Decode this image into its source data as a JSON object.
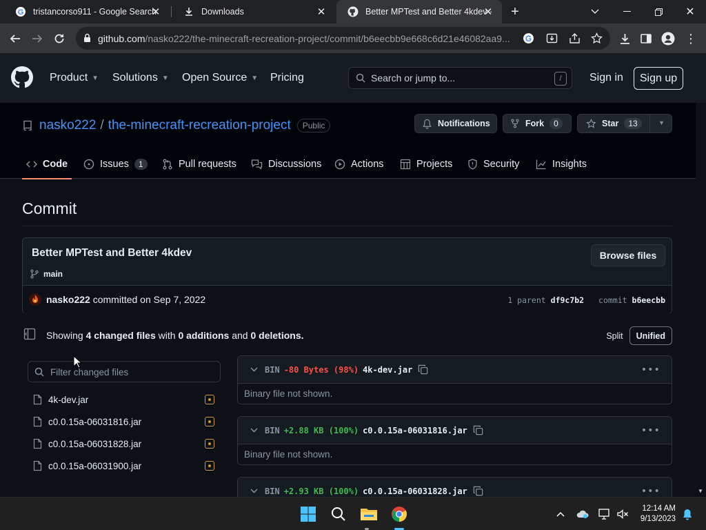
{
  "browser": {
    "tabs": [
      {
        "title": "tristancorso911 - Google Search",
        "icon": "google-icon"
      },
      {
        "title": "Downloads",
        "icon": "download-icon"
      },
      {
        "title": "Better MPTest and Better 4kdev ·",
        "icon": "github-icon",
        "active": true
      }
    ],
    "url_host": "github.com",
    "url_path": "/nasko222/the-minecraft-recreation-project/commit/b6eecbb9e668c6d21e46082aa9..."
  },
  "gh_header": {
    "nav": [
      "Product",
      "Solutions",
      "Open Source",
      "Pricing"
    ],
    "search_placeholder": "Search or jump to...",
    "search_shortcut": "/",
    "sign_in": "Sign in",
    "sign_up": "Sign up"
  },
  "repo": {
    "owner": "nasko222",
    "name": "the-minecraft-recreation-project",
    "visibility": "Public",
    "notifications_label": "Notifications",
    "fork_label": "Fork",
    "fork_count": "0",
    "star_label": "Star",
    "star_count": "13",
    "tabs": [
      {
        "label": "Code",
        "icon": "code-icon",
        "active": true
      },
      {
        "label": "Issues",
        "icon": "issue-icon",
        "count": "1"
      },
      {
        "label": "Pull requests",
        "icon": "pull-request-icon"
      },
      {
        "label": "Discussions",
        "icon": "discussion-icon"
      },
      {
        "label": "Actions",
        "icon": "play-icon"
      },
      {
        "label": "Projects",
        "icon": "table-icon"
      },
      {
        "label": "Security",
        "icon": "shield-icon"
      },
      {
        "label": "Insights",
        "icon": "graph-icon"
      }
    ]
  },
  "commit": {
    "page_heading": "Commit",
    "message": "Better MPTest and Better 4kdev",
    "branch": "main",
    "browse_files": "Browse files",
    "author": "nasko222",
    "committed_text": "committed on Sep 7, 2022",
    "parent_count_label": "1 parent",
    "parent_sha": "df9c7b2",
    "commit_label": "commit",
    "commit_sha": "b6eecbb"
  },
  "summary": {
    "showing": "Showing",
    "changed_files": "4 changed files",
    "with": "with",
    "additions": "0 additions",
    "and": "and",
    "deletions": "0 deletions.",
    "split": "Split",
    "unified": "Unified"
  },
  "file_tree": {
    "filter_placeholder": "Filter changed files",
    "files": [
      "4k-dev.jar",
      "c0.0.15a-06031816.jar",
      "c0.0.15a-06031828.jar",
      "c0.0.15a-06031900.jar"
    ]
  },
  "diffs": [
    {
      "type": "BIN",
      "change": "-80 Bytes (98%)",
      "sign": "neg",
      "file": "4k-dev.jar",
      "body": "Binary file not shown."
    },
    {
      "type": "BIN",
      "change": "+2.88 KB (100%)",
      "sign": "pos",
      "file": "c0.0.15a-06031816.jar",
      "body": "Binary file not shown."
    },
    {
      "type": "BIN",
      "change": "+2.93 KB (100%)",
      "sign": "pos",
      "file": "c0.0.15a-06031828.jar",
      "body": ""
    }
  ],
  "taskbar": {
    "time": "12:14 AM",
    "date": "9/13/2023"
  },
  "colors": {
    "bg": "#0d1117",
    "header_bg": "#161b22",
    "link": "#4493f8",
    "added": "#3fb950",
    "removed": "#f85149",
    "active_tab_underline": "#fd8c73",
    "modified": "#d29922"
  }
}
